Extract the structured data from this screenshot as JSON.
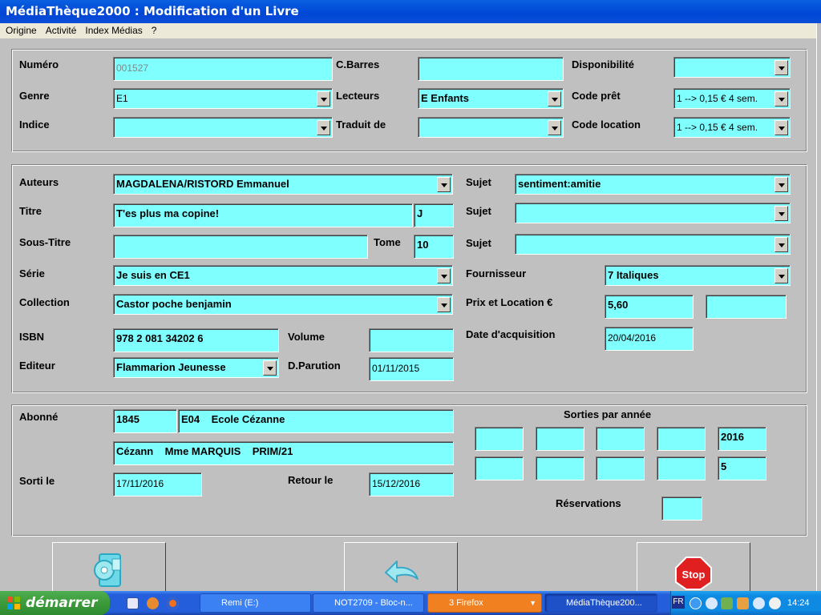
{
  "window": {
    "title": "MédiaThèque2000 : Modification d'un Livre"
  },
  "menu": [
    "Origine",
    "Activité",
    "Index Médias",
    "?"
  ],
  "section1": {
    "numero": {
      "label": "Numéro",
      "value": "001527"
    },
    "cbarres": {
      "label": "C.Barres",
      "value": ""
    },
    "disponibilite": {
      "label": "Disponibilité",
      "value": ""
    },
    "genre": {
      "label": "Genre",
      "value": "E1"
    },
    "lecteurs": {
      "label": "Lecteurs",
      "value": "E Enfants"
    },
    "code_pret": {
      "label": "Code prêt",
      "value": "1 --> 0,15 € 4 sem."
    },
    "indice": {
      "label": "Indice",
      "value": ""
    },
    "traduit_de": {
      "label": "Traduit de",
      "value": ""
    },
    "code_location": {
      "label": "Code location",
      "value": "1 --> 0,15 € 4 sem."
    }
  },
  "section2": {
    "auteurs": {
      "label": "Auteurs",
      "value": "MAGDALENA/RISTORD Emmanuel"
    },
    "titre": {
      "label": "Titre",
      "value": "T'es plus ma copine!",
      "extra": "J"
    },
    "sous_titre": {
      "label": "Sous-Titre",
      "value": ""
    },
    "tome": {
      "label": "Tome",
      "value": "10"
    },
    "serie": {
      "label": "Série",
      "value": "Je suis en CE1"
    },
    "collection": {
      "label": "Collection",
      "value": "Castor poche benjamin"
    },
    "isbn": {
      "label": "ISBN",
      "value": "978 2 081 34202 6"
    },
    "volume": {
      "label": "Volume",
      "value": ""
    },
    "editeur": {
      "label": "Editeur",
      "value": "Flammarion Jeunesse"
    },
    "d_parution": {
      "label": "D.Parution",
      "value": "01/11/2015"
    },
    "sujets": [
      {
        "label": "Sujet",
        "value": "sentiment:amitie"
      },
      {
        "label": "Sujet",
        "value": ""
      },
      {
        "label": "Sujet",
        "value": ""
      }
    ],
    "fournisseur": {
      "label": "Fournisseur",
      "value": "7 Italiques"
    },
    "prix_location": {
      "label": "Prix et Location €",
      "prix": "5,60",
      "location": ""
    },
    "date_acquisition": {
      "label": "Date d'acquisition",
      "value": "20/04/2016"
    }
  },
  "section3": {
    "abonne": {
      "label": "Abonné",
      "numero": "1845",
      "classe": "E04    Ecole Cézanne",
      "detail": "Cézann    Mme MARQUIS    PRIM/21"
    },
    "sorti_le": {
      "label": "Sorti le",
      "value": "17/11/2016"
    },
    "retour_le": {
      "label": "Retour le",
      "value": "15/12/2016"
    },
    "sorties_par_annee": {
      "label": "Sorties par année",
      "years": [
        "",
        "",
        "",
        "",
        "2016"
      ],
      "counts": [
        "",
        "",
        "",
        "",
        "5"
      ]
    },
    "reservations": {
      "label": "Réservations",
      "value": ""
    }
  },
  "toolbar": [
    {
      "icon": "save-disk-icon"
    },
    {
      "icon": "undo-arrow-icon"
    },
    {
      "icon": "stop-sign-icon",
      "text": "Stop"
    }
  ],
  "taskbar": {
    "start": "démarrer",
    "tasks": [
      "Remi (E:)",
      "NOT2709 - Bloc-n...",
      "3 Firefox",
      "MédiaThèque200..."
    ],
    "lang": "FR",
    "clock": "14:24"
  }
}
